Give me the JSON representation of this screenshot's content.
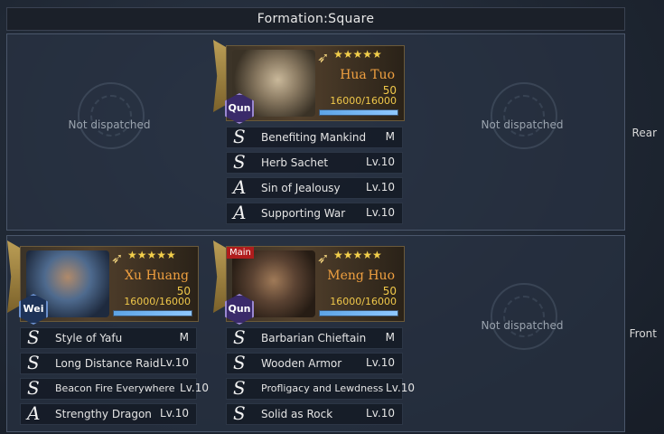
{
  "header": {
    "title": "Formation:Square"
  },
  "rows": {
    "rear_label": "Rear",
    "front_label": "Front"
  },
  "empty_text": "Not dispatched",
  "colors": {
    "accent_name": "#f0a040",
    "stars": "#f3cf4b",
    "troop_bar": "#5da4e6"
  },
  "generals": {
    "hua_tuo": {
      "name": "Hua Tuo",
      "faction": "Qun",
      "stars": "★★★★★",
      "level": "50",
      "troops": "16000/16000",
      "troop_fraction": 1.0,
      "main": "",
      "skills": [
        {
          "grade": "S",
          "name": "Benefiting Mankind",
          "level": "M"
        },
        {
          "grade": "S",
          "name": "Herb Sachet",
          "level": "Lv.10"
        },
        {
          "grade": "A",
          "name": "Sin of Jealousy",
          "level": "Lv.10"
        },
        {
          "grade": "A",
          "name": "Supporting War",
          "level": "Lv.10"
        }
      ]
    },
    "xu_huang": {
      "name": "Xu Huang",
      "faction": "Wei",
      "stars": "★★★★★",
      "level": "50",
      "troops": "16000/16000",
      "troop_fraction": 1.0,
      "main": "",
      "skills": [
        {
          "grade": "S",
          "name": "Style of Yafu",
          "level": "M"
        },
        {
          "grade": "S",
          "name": "Long Distance Raid",
          "level": "Lv.10"
        },
        {
          "grade": "S",
          "name": "Beacon Fire Everywhere",
          "level": "Lv.10"
        },
        {
          "grade": "A",
          "name": "Strengthy Dragon",
          "level": "Lv.10"
        }
      ]
    },
    "meng_huo": {
      "name": "Meng Huo",
      "faction": "Qun",
      "stars": "★★★★★",
      "level": "50",
      "troops": "16000/16000",
      "troop_fraction": 1.0,
      "main": "Main",
      "skills": [
        {
          "grade": "S",
          "name": "Barbarian Chieftain",
          "level": "M"
        },
        {
          "grade": "S",
          "name": "Wooden Armor",
          "level": "Lv.10"
        },
        {
          "grade": "S",
          "name": "Profligacy and Lewdness",
          "level": "Lv.10"
        },
        {
          "grade": "S",
          "name": "Solid as Rock",
          "level": "Lv.10"
        }
      ]
    }
  }
}
